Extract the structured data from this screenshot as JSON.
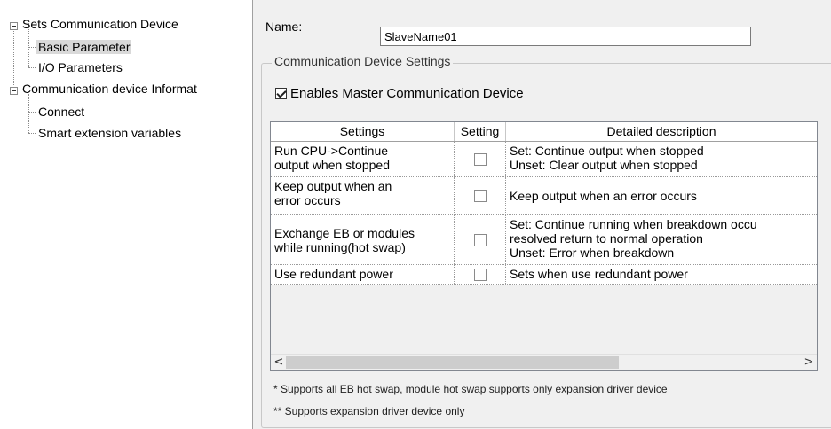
{
  "tree": {
    "items": [
      {
        "label": "Sets Communication Device",
        "level": 0
      },
      {
        "label": "Basic Parameter",
        "level": 1,
        "selected": true
      },
      {
        "label": "I/O Parameters",
        "level": 1
      },
      {
        "label": "Communication device Informat",
        "level": 0
      },
      {
        "label": "Connect",
        "level": 1
      },
      {
        "label": "Smart extension variables",
        "level": 1
      }
    ]
  },
  "name": {
    "label": "Name:",
    "value": "SlaveName01"
  },
  "group": {
    "legend": "Communication Device Settings"
  },
  "enable": {
    "label": "Enables Master Communication Device",
    "checked": true
  },
  "table": {
    "columns": [
      "Settings",
      "Setting",
      "Detailed description"
    ],
    "rows": [
      {
        "setting": [
          "Run CPU->Continue",
          "output when stopped"
        ],
        "checked": false,
        "description": [
          "Set: Continue output when stopped",
          "Unset: Clear output when stopped"
        ]
      },
      {
        "setting": [
          "Keep output when an",
          "error occurs"
        ],
        "checked": false,
        "description": [
          "Keep output when an error occurs"
        ]
      },
      {
        "setting": [
          "Exchange EB or modules",
          "while running(hot swap)"
        ],
        "checked": false,
        "description": [
          "Set: Continue running when breakdown occu",
          "resolved return to normal operation",
          "Unset: Error when breakdown"
        ]
      },
      {
        "setting": [
          "Use redundant power"
        ],
        "checked": false,
        "description": [
          "Sets when use redundant power"
        ]
      }
    ]
  },
  "scroll": {
    "left_arrow": "<",
    "right_arrow": ">"
  },
  "notes": [
    "* Supports all EB hot swap, module hot swap supports only expansion driver device",
    "** Supports expansion driver device only"
  ]
}
